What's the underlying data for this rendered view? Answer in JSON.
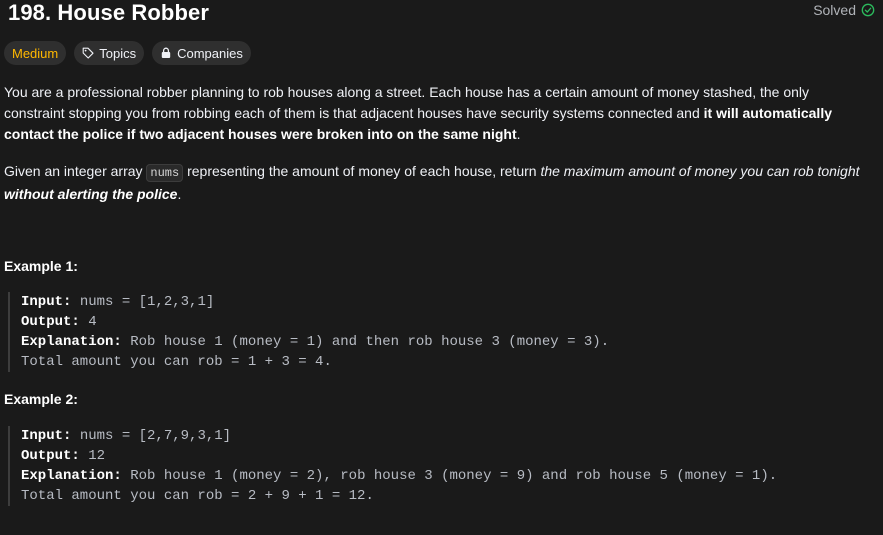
{
  "problem": {
    "title": "198. House Robber",
    "status": "Solved"
  },
  "tags": {
    "difficulty": "Medium",
    "topics": "Topics",
    "companies": "Companies"
  },
  "description": {
    "p1_start": "You are a professional robber planning to rob houses along a street. Each house has a certain amount of money stashed, the only constraint stopping you from robbing each of them is that adjacent houses have security systems connected and ",
    "p1_bold": "it will automatically contact the police if two adjacent houses were broken into on the same night",
    "p1_end": ".",
    "p2_start": "Given an integer array ",
    "p2_code": "nums",
    "p2_mid": " representing the amount of money of each house, return ",
    "p2_italic": "the maximum amount of money you can rob tonight ",
    "p2_bold_italic": "without alerting the police",
    "p2_end": "."
  },
  "examples": [
    {
      "heading": "Example 1:",
      "input_label": "Input:",
      "input": " nums = [1,2,3,1]",
      "output_label": "Output:",
      "output": " 4",
      "explanation_label": "Explanation:",
      "explanation": " Rob house 1 (money = 1) and then rob house 3 (money = 3).",
      "explanation_line2": "Total amount you can rob = 1 + 3 = 4."
    },
    {
      "heading": "Example 2:",
      "input_label": "Input:",
      "input": " nums = [2,7,9,3,1]",
      "output_label": "Output:",
      "output": " 12",
      "explanation_label": "Explanation:",
      "explanation": " Rob house 1 (money = 2), rob house 3 (money = 9) and rob house 5 (money = 1).",
      "explanation_line2": "Total amount you can rob = 2 + 9 + 1 = 12."
    }
  ],
  "colors": {
    "background": "#1a1a1a",
    "medium": "#ffb800",
    "solved_check": "#2cbb5d"
  },
  "icons": {
    "solved": "check-circle-icon",
    "topics": "tag-icon",
    "companies": "lock-icon"
  }
}
